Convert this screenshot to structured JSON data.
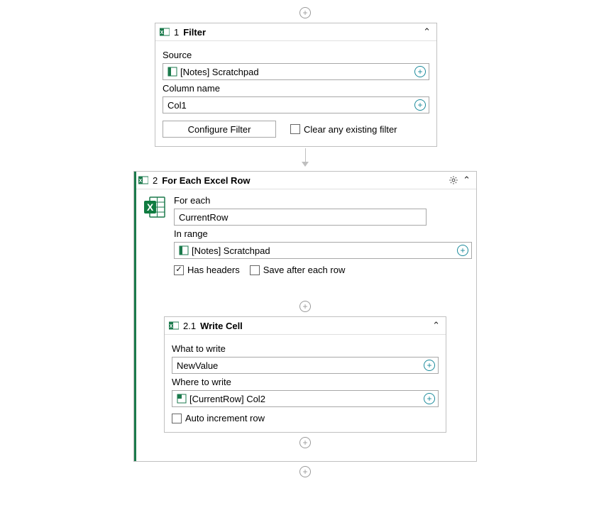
{
  "filter": {
    "num": "1",
    "title": "Filter",
    "source_label": "Source",
    "source_value": "[Notes] Scratchpad",
    "column_label": "Column name",
    "column_value": "Col1",
    "configure_btn": "Configure Filter",
    "clear_check_label": "Clear any existing filter",
    "clear_checked": false
  },
  "foreach": {
    "num": "2",
    "title": "For Each Excel Row",
    "for_each_label": "For each",
    "for_each_value": "CurrentRow",
    "in_range_label": "In range",
    "in_range_value": "[Notes] Scratchpad",
    "has_headers_label": "Has headers",
    "has_headers_checked": true,
    "save_after_label": "Save after each row",
    "save_after_checked": false
  },
  "writecell": {
    "num": "2.1",
    "title": "Write Cell",
    "what_label": "What to write",
    "what_value": "NewValue",
    "where_label": "Where to write",
    "where_value": "[CurrentRow] Col2",
    "auto_inc_label": "Auto increment row",
    "auto_inc_checked": false
  }
}
